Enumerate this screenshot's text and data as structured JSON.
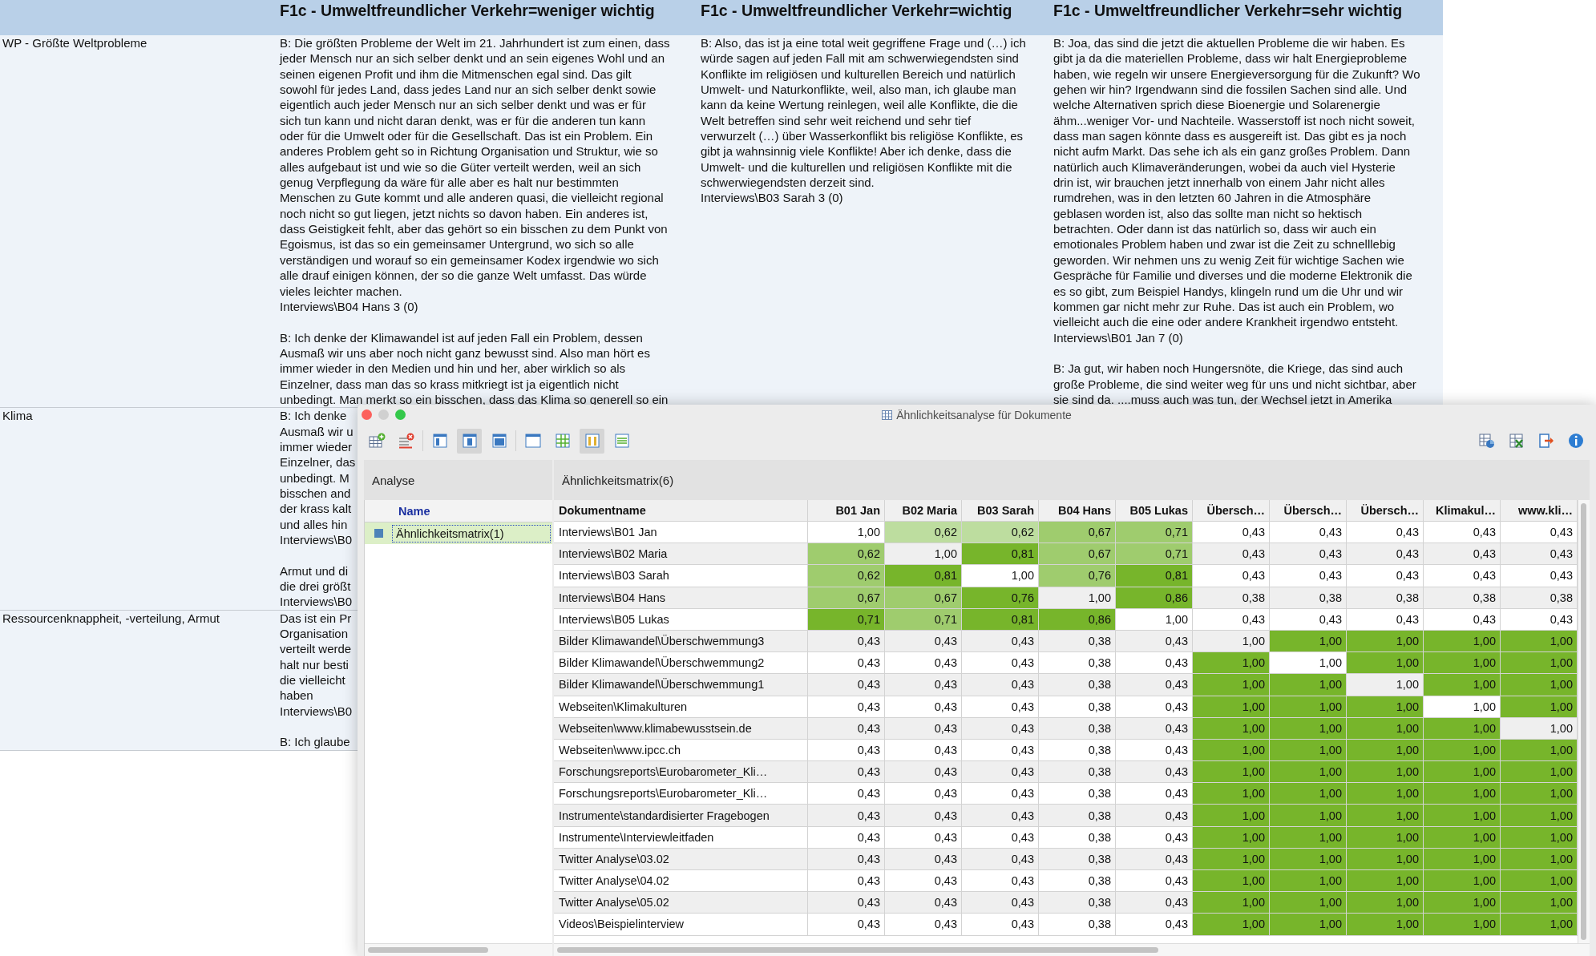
{
  "background_table": {
    "headers": [
      "F1c - Umweltfreundlicher Verkehr=weniger wichtig",
      "F1c - Umweltfreundlicher Verkehr=wichtig",
      "F1c - Umweltfreundlicher Verkehr=sehr wichtig"
    ],
    "rows": [
      {
        "code": "WP - Größte Weltprobleme",
        "cells": [
          [
            {
              "lines": [
                "B: Die größten Probleme der Welt im 21. Jahrhundert ist zum einen, dass",
                "jeder Mensch nur an sich selber denkt und an sein eigenes Wohl und an",
                "seinen eigenen Profit und ihm die Mitmenschen egal sind. Das gilt",
                "sowohl für jedes Land, dass jedes Land nur an sich selber denkt sowie",
                "eigentlich auch jeder Mensch nur an sich selber denkt und was er für",
                "sich tun kann und nicht daran denkt, was er für die anderen tun kann",
                "oder für die Umwelt oder für die Gesellschaft. Das ist ein Problem. Ein",
                "anderes Problem geht so in Richtung Organisation und Struktur, wie so",
                "alles aufgebaut ist und wie so die Güter verteilt werden, weil an sich",
                "genug Verpflegung da wäre für alle aber es halt nur bestimmten",
                "Menschen zu Gute kommt und alle anderen quasi, die vielleicht regional",
                "noch nicht so gut liegen, jetzt nichts so davon haben. Ein anderes ist,",
                "dass Geistigkeit fehlt, aber das gehört so ein bisschen zu dem Punkt von",
                "Egoismus, ist das so ein gemeinsamer Untergrund, wo sich so alle",
                "verständigen und worauf so ein gemeinsamer Kodex irgendwie wo sich",
                "alle drauf einigen können, der so die ganze Welt umfasst. Das würde",
                "vieles leichter machen."
              ],
              "source": "Interviews\\B04 Hans 3 (0)"
            },
            {
              "lines": [
                "B: Ich denke der Klimawandel ist auf jeden Fall ein Problem, dessen",
                "Ausmaß wir uns aber noch nicht ganz bewusst sind. Also man hört es",
                "immer wieder in den Medien und hin und her, aber wirklich so als",
                "Einzelner, dass man das so krass mitkriegt ist ja eigentlich nicht",
                "unbedingt. Man merkt so ein bisschen, dass das Klima so generell so ein"
              ]
            }
          ],
          [
            {
              "lines": [
                "B: Also, das ist ja eine total weit gegriffene Frage und (…) ich",
                "würde sagen auf jeden Fall mit am schwerwiegendsten sind",
                "Konflikte im religiösen und kulturellen Bereich und natürlich",
                "Umwelt- und Naturkonflikte, weil, also man, ich glaube man",
                "kann da keine Wertung reinlegen, weil alle Konflikte, die die",
                "Welt betreffen sind sehr weit reichend und sehr tief",
                "verwurzelt (…) über Wasserkonflikt bis religiöse Konflikte, es",
                "gibt ja wahnsinnig viele Konflikte! Aber ich denke, dass die",
                "Umwelt- und die kulturellen und religiösen Konflikte mit die",
                "schwerwiegendsten derzeit sind."
              ],
              "source": "Interviews\\B03 Sarah 3 (0)"
            }
          ],
          [
            {
              "lines": [
                "B: Joa, das sind die jetzt die aktuellen Probleme die wir haben. Es",
                "gibt ja da die materiellen Probleme, dass wir halt Energieprobleme",
                "haben, wie regeln wir unsere Energieversorgung für die Zukunft? Wo",
                "gehen wir hin? Irgendwann sind die fossilen Sachen sind alle. Und",
                "welche Alternativen sprich diese Bioenergie und Solarenergie",
                "ähm...weniger Vor- und Nachteile. Wasserstoff ist noch nicht soweit,",
                "dass man sagen könnte dass es ausgereift ist. Das gibt es ja noch",
                "nicht aufm Markt. Das sehe ich als ein ganz großes Problem. Dann",
                "natürlich auch Klimaveränderungen, wobei da auch viel Hysterie",
                "drin ist, wir brauchen jetzt innerhalb von einem Jahr nicht alles",
                "rumdrehen, was in den letzten 60 Jahren in die Atmosphäre",
                "geblasen worden ist, also das sollte man nicht so hektisch",
                "betrachten. Oder dann ist das natürlich so, dass wir auch ein",
                "emotionales Problem haben und zwar ist die Zeit zu schnelllebig",
                "geworden. Wir nehmen uns zu wenig Zeit für wichtige Sachen wie",
                "Gespräche für Familie und diverses und die moderne Elektronik die",
                "es so gibt, zum Beispiel Handys, klingeln rund um die Uhr und wir",
                "kommen gar nicht mehr zur Ruhe. Das ist auch ein Problem, wo",
                "vielleicht auch die eine oder andere Krankheit irgendwo entsteht."
              ],
              "source": "Interviews\\B01 Jan 7 (0)"
            },
            {
              "lines": [
                "B: Ja gut, wir haben noch Hungersnöte, die Kriege, das sind auch",
                "große Probleme, die sind weiter weg für uns und nicht sichtbar, aber",
                "sie sind da. ....muss auch was tun, der Wechsel jetzt in Amerika"
              ]
            }
          ]
        ]
      },
      {
        "code": "Klima",
        "cells": [
          [
            {
              "lines": [
                "B: Ich denke",
                "Ausmaß wir u",
                "immer wieder",
                "Einzelner, das",
                "unbedingt. M",
                "bisschen and",
                "der krass kalt",
                "und alles hin"
              ],
              "source": "Interviews\\B0"
            },
            {
              "lines": [
                "Armut und di",
                "die drei größt"
              ],
              "source": "Interviews\\B0"
            }
          ]
        ]
      },
      {
        "code": "Ressourcenknappheit, -verteilung, Armut",
        "cells": [
          [
            {
              "lines": [
                "Das ist ein Pr",
                "Organisation",
                "verteilt werde",
                "halt nur besti",
                "die vielleicht",
                "haben"
              ],
              "source": "Interviews\\B0"
            },
            {
              "lines": [
                "B: Ich glaube"
              ]
            }
          ]
        ]
      }
    ]
  },
  "window": {
    "title": "Ähnlichkeitsanalyse für Dokumente",
    "toolbar": {
      "left": [
        [
          {
            "kind": "table-add",
            "pressed": false
          },
          {
            "kind": "table-remove",
            "pressed": false
          }
        ],
        [
          {
            "kind": "panel-left",
            "pressed": false
          },
          {
            "kind": "panel-center",
            "pressed": true
          },
          {
            "kind": "panel-full",
            "pressed": false
          }
        ],
        [
          {
            "kind": "frame",
            "pressed": false
          },
          {
            "kind": "grid",
            "pressed": false
          },
          {
            "kind": "columns",
            "pressed": true
          },
          {
            "kind": "rows",
            "pressed": false
          }
        ]
      ],
      "right": [
        {
          "kind": "chart-export",
          "pressed": false
        },
        {
          "kind": "excel-export",
          "pressed": false
        },
        {
          "kind": "exit",
          "pressed": false
        },
        {
          "kind": "info",
          "pressed": false
        }
      ]
    },
    "analysis": {
      "title": "Analyse",
      "column": "Name",
      "items": [
        {
          "name": "Ähnlichkeitsmatrix(1)",
          "selected": true
        }
      ]
    },
    "matrix": {
      "title": "Ähnlichkeitsmatrix(6)",
      "name_column": "Dokumentname",
      "columns": [
        "B01 Jan",
        "B02 Maria",
        "B03 Sarah",
        "B04 Hans",
        "B05 Lukas",
        "Übersch…",
        "Übersch…",
        "Übersch…",
        "Klimakul…",
        "www.kli…"
      ],
      "rows": [
        {
          "name": "Interviews\\B01 Jan",
          "cells": [
            "1,00",
            {
              "value": "0,62",
              "color": "#bddd9f"
            },
            {
              "value": "0,62",
              "color": "#bddd9f"
            },
            {
              "value": "0,67",
              "color": "#9fcc6e"
            },
            {
              "value": "0,71",
              "color": "#9fcc6e"
            },
            "0,43",
            "0,43",
            "0,43",
            "0,43",
            "0,43"
          ]
        },
        {
          "name": "Interviews\\B02 Maria",
          "cells": [
            {
              "value": "0,62",
              "color": "#9fcc6e"
            },
            "1,00",
            {
              "value": "0,81",
              "color": "#77b52b"
            },
            {
              "value": "0,67",
              "color": "#9fcc6e"
            },
            {
              "value": "0,71",
              "color": "#9fcc6e"
            },
            "0,43",
            "0,43",
            "0,43",
            "0,43",
            "0,43"
          ]
        },
        {
          "name": "Interviews\\B03 Sarah",
          "cells": [
            {
              "value": "0,62",
              "color": "#9fcc6e"
            },
            {
              "value": "0,81",
              "color": "#77b52b"
            },
            "1,00",
            {
              "value": "0,76",
              "color": "#9fcc6e"
            },
            {
              "value": "0,81",
              "color": "#77b52b"
            },
            "0,43",
            "0,43",
            "0,43",
            "0,43",
            "0,43"
          ]
        },
        {
          "name": "Interviews\\B04 Hans",
          "cells": [
            {
              "value": "0,67",
              "color": "#9fcc6e"
            },
            {
              "value": "0,67",
              "color": "#9fcc6e"
            },
            {
              "value": "0,76",
              "color": "#77b52b"
            },
            "1,00",
            {
              "value": "0,86",
              "color": "#77b52b"
            },
            "0,38",
            "0,38",
            "0,38",
            "0,38",
            "0,38"
          ]
        },
        {
          "name": "Interviews\\B05 Lukas",
          "cells": [
            {
              "value": "0,71",
              "color": "#77b52b"
            },
            {
              "value": "0,71",
              "color": "#9fcc6e"
            },
            {
              "value": "0,81",
              "color": "#77b52b"
            },
            {
              "value": "0,86",
              "color": "#77b52b"
            },
            "1,00",
            "0,43",
            "0,43",
            "0,43",
            "0,43",
            "0,43"
          ]
        },
        {
          "name": "Bilder Klimawandel\\Überschwemmung3",
          "cells": [
            "0,43",
            "0,43",
            "0,43",
            "0,38",
            "0,43",
            "1,00",
            {
              "value": "1,00",
              "color": "#77b52b"
            },
            {
              "value": "1,00",
              "color": "#77b52b"
            },
            {
              "value": "1,00",
              "color": "#77b52b"
            },
            {
              "value": "1,00",
              "color": "#77b52b"
            }
          ]
        },
        {
          "name": "Bilder Klimawandel\\Überschwemmung2",
          "cells": [
            "0,43",
            "0,43",
            "0,43",
            "0,38",
            "0,43",
            {
              "value": "1,00",
              "color": "#77b52b"
            },
            "1,00",
            {
              "value": "1,00",
              "color": "#77b52b"
            },
            {
              "value": "1,00",
              "color": "#77b52b"
            },
            {
              "value": "1,00",
              "color": "#77b52b"
            }
          ]
        },
        {
          "name": "Bilder Klimawandel\\Überschwemmung1",
          "cells": [
            "0,43",
            "0,43",
            "0,43",
            "0,38",
            "0,43",
            {
              "value": "1,00",
              "color": "#77b52b"
            },
            {
              "value": "1,00",
              "color": "#77b52b"
            },
            "1,00",
            {
              "value": "1,00",
              "color": "#77b52b"
            },
            {
              "value": "1,00",
              "color": "#77b52b"
            }
          ]
        },
        {
          "name": "Webseiten\\Klimakulturen",
          "cells": [
            "0,43",
            "0,43",
            "0,43",
            "0,38",
            "0,43",
            {
              "value": "1,00",
              "color": "#77b52b"
            },
            {
              "value": "1,00",
              "color": "#77b52b"
            },
            {
              "value": "1,00",
              "color": "#77b52b"
            },
            "1,00",
            {
              "value": "1,00",
              "color": "#77b52b"
            }
          ]
        },
        {
          "name": "Webseiten\\www.klimabewusstsein.de",
          "cells": [
            "0,43",
            "0,43",
            "0,43",
            "0,38",
            "0,43",
            {
              "value": "1,00",
              "color": "#77b52b"
            },
            {
              "value": "1,00",
              "color": "#77b52b"
            },
            {
              "value": "1,00",
              "color": "#77b52b"
            },
            {
              "value": "1,00",
              "color": "#77b52b"
            },
            "1,00"
          ]
        },
        {
          "name": "Webseiten\\www.ipcc.ch",
          "cells": [
            "0,43",
            "0,43",
            "0,43",
            "0,38",
            "0,43",
            {
              "value": "1,00",
              "color": "#77b52b"
            },
            {
              "value": "1,00",
              "color": "#77b52b"
            },
            {
              "value": "1,00",
              "color": "#77b52b"
            },
            {
              "value": "1,00",
              "color": "#77b52b"
            },
            {
              "value": "1,00",
              "color": "#77b52b"
            }
          ]
        },
        {
          "name": "Forschungsreports\\Eurobarometer_Kli…",
          "cells": [
            "0,43",
            "0,43",
            "0,43",
            "0,38",
            "0,43",
            {
              "value": "1,00",
              "color": "#77b52b"
            },
            {
              "value": "1,00",
              "color": "#77b52b"
            },
            {
              "value": "1,00",
              "color": "#77b52b"
            },
            {
              "value": "1,00",
              "color": "#77b52b"
            },
            {
              "value": "1,00",
              "color": "#77b52b"
            }
          ]
        },
        {
          "name": "Forschungsreports\\Eurobarometer_Kli…",
          "cells": [
            "0,43",
            "0,43",
            "0,43",
            "0,38",
            "0,43",
            {
              "value": "1,00",
              "color": "#77b52b"
            },
            {
              "value": "1,00",
              "color": "#77b52b"
            },
            {
              "value": "1,00",
              "color": "#77b52b"
            },
            {
              "value": "1,00",
              "color": "#77b52b"
            },
            {
              "value": "1,00",
              "color": "#77b52b"
            }
          ]
        },
        {
          "name": "Instrumente\\standardisierter Fragebogen",
          "cells": [
            "0,43",
            "0,43",
            "0,43",
            "0,38",
            "0,43",
            {
              "value": "1,00",
              "color": "#77b52b"
            },
            {
              "value": "1,00",
              "color": "#77b52b"
            },
            {
              "value": "1,00",
              "color": "#77b52b"
            },
            {
              "value": "1,00",
              "color": "#77b52b"
            },
            {
              "value": "1,00",
              "color": "#77b52b"
            }
          ]
        },
        {
          "name": "Instrumente\\Interviewleitfaden",
          "cells": [
            "0,43",
            "0,43",
            "0,43",
            "0,38",
            "0,43",
            {
              "value": "1,00",
              "color": "#77b52b"
            },
            {
              "value": "1,00",
              "color": "#77b52b"
            },
            {
              "value": "1,00",
              "color": "#77b52b"
            },
            {
              "value": "1,00",
              "color": "#77b52b"
            },
            {
              "value": "1,00",
              "color": "#77b52b"
            }
          ]
        },
        {
          "name": "Twitter Analyse\\03.02",
          "cells": [
            "0,43",
            "0,43",
            "0,43",
            "0,38",
            "0,43",
            {
              "value": "1,00",
              "color": "#77b52b"
            },
            {
              "value": "1,00",
              "color": "#77b52b"
            },
            {
              "value": "1,00",
              "color": "#77b52b"
            },
            {
              "value": "1,00",
              "color": "#77b52b"
            },
            {
              "value": "1,00",
              "color": "#77b52b"
            }
          ]
        },
        {
          "name": "Twitter Analyse\\04.02",
          "cells": [
            "0,43",
            "0,43",
            "0,43",
            "0,38",
            "0,43",
            {
              "value": "1,00",
              "color": "#77b52b"
            },
            {
              "value": "1,00",
              "color": "#77b52b"
            },
            {
              "value": "1,00",
              "color": "#77b52b"
            },
            {
              "value": "1,00",
              "color": "#77b52b"
            },
            {
              "value": "1,00",
              "color": "#77b52b"
            }
          ]
        },
        {
          "name": "Twitter Analyse\\05.02",
          "cells": [
            "0,43",
            "0,43",
            "0,43",
            "0,38",
            "0,43",
            {
              "value": "1,00",
              "color": "#77b52b"
            },
            {
              "value": "1,00",
              "color": "#77b52b"
            },
            {
              "value": "1,00",
              "color": "#77b52b"
            },
            {
              "value": "1,00",
              "color": "#77b52b"
            },
            {
              "value": "1,00",
              "color": "#77b52b"
            }
          ]
        },
        {
          "name": "Videos\\Beispielinterview",
          "cells": [
            "0,43",
            "0,43",
            "0,43",
            "0,38",
            "0,43",
            {
              "value": "1,00",
              "color": "#77b52b"
            },
            {
              "value": "1,00",
              "color": "#77b52b"
            },
            {
              "value": "1,00",
              "color": "#77b52b"
            },
            {
              "value": "1,00",
              "color": "#77b52b"
            },
            {
              "value": "1,00",
              "color": "#77b52b"
            }
          ]
        }
      ]
    }
  }
}
